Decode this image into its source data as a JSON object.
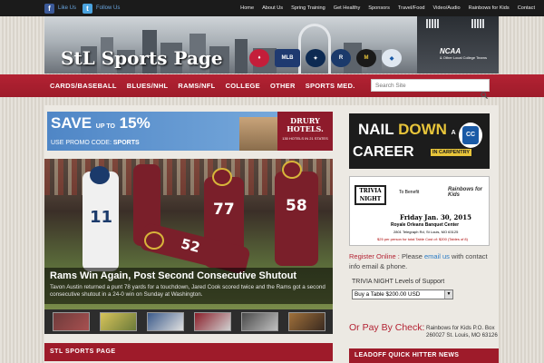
{
  "topbar": {
    "facebook_label": "Like Us",
    "twitter_label": "Follow Us",
    "nav": [
      "Home",
      "About Us",
      "Spring Training",
      "Get Healthy",
      "Sponsors",
      "Travel/Food",
      "Video/Audio",
      "Rainbows for Kids",
      "Contact"
    ]
  },
  "header": {
    "site_title": "StL Sports Page",
    "logo_ncaa": "NCAA",
    "logo_ncaa_sub": "& Other Local College Teams"
  },
  "mainnav": {
    "items": [
      "CARDS/BASEBALL",
      "BLUES/NHL",
      "RAMS/NFL",
      "COLLEGE",
      "OTHER",
      "SPORTS MED."
    ],
    "search_placeholder": "Search Site"
  },
  "ad_drury": {
    "save": "SAVE",
    "upto": "UP TO",
    "percent": "15%",
    "promo_prefix": "USE PROMO CODE:",
    "promo_code": "SPORTS",
    "brand": "DRURY HOTELS.",
    "brand_sub": "130 HOTELS IN 21 STATES"
  },
  "hero": {
    "headline": "Rams Win Again, Post Second Consecutive Shutout",
    "summary": "Tavon Austin returned a punt 78 yards for a touchdown, Jared Cook scored twice and the Rams got a second consecutive shutout in a 24-0 win on Sunday at Washington.",
    "numbers": [
      "11",
      "77",
      "58",
      "52"
    ]
  },
  "section_title": "STL SPORTS PAGE",
  "side_ad_career": {
    "line1a": "NAIL",
    "line1b": "DOWN",
    "tag1": "A",
    "line2": "CAREER",
    "tag2": "IN CARPENTRY",
    "shield": "CC"
  },
  "side_ad_trivia": {
    "trivia": "TRIVIA NIGHT",
    "to_benefit": "To Benefit",
    "kids": "Rainbows for Kids",
    "date": "Friday Jan. 30, 2015",
    "venue": "Royale Orleans Banquet Center",
    "address": "2801 Telegraph Rd, St Louis, MO 63125",
    "price": "$25 per person for total Table Cost of: $200 (Tables of 8)"
  },
  "register": {
    "label": "Register Online :",
    "text1": "Please",
    "link": "email us",
    "text2": "with contact info email & phone."
  },
  "levels": {
    "label": "TRIVIA NIGHT Levels of Support",
    "selected": "Buy a Table $200.00 USD"
  },
  "pay": {
    "label": "Or Pay By Check:",
    "info": "Rainbows for Kids P.O. Box 260027  St. Louis, MO 63126"
  },
  "side_section_title": "LEADOFF QUICK HITTER NEWS",
  "colors": {
    "accent": "#9e1b2a",
    "link": "#2a7bc4"
  }
}
